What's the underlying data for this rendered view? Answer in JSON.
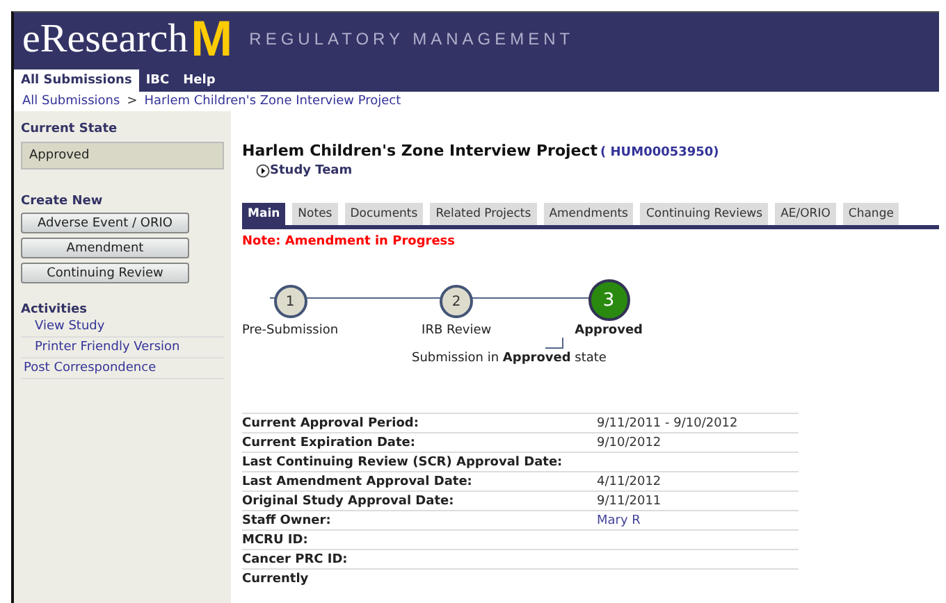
{
  "header": {
    "brand": "eResearch",
    "logo_letter": "M",
    "product": "REGULATORY MANAGEMENT"
  },
  "nav": [
    {
      "label": "All Submissions",
      "selected": true
    },
    {
      "label": "IBC",
      "selected": false
    },
    {
      "label": "Help",
      "selected": false
    }
  ],
  "breadcrumb": [
    "All Submissions",
    ">",
    "Harlem Children's Zone Interview Project"
  ],
  "sidebar": {
    "current_state_title": "Current State",
    "current_state": "Approved",
    "create_new_title": "Create New",
    "create_buttons": [
      "Adverse Event / ORIO",
      "Amendment",
      "Continuing Review"
    ],
    "activities_title": "Activities",
    "activities": [
      {
        "label": "View Study",
        "kind": "sub"
      },
      {
        "label": "Printer Friendly Version",
        "kind": "sub"
      },
      {
        "label": "Post Correspondence",
        "kind": "main"
      }
    ]
  },
  "project": {
    "title": "Harlem Children's Zone Interview Project",
    "id": "( HUM00053950)",
    "study_team": "Study Team"
  },
  "tabs": [
    {
      "label": "Main",
      "selected": true
    },
    {
      "label": "Notes",
      "selected": false
    },
    {
      "label": "Documents",
      "selected": false
    },
    {
      "label": "Related Projects",
      "selected": false
    },
    {
      "label": "Amendments",
      "selected": false
    },
    {
      "label": "Continuing Reviews",
      "selected": false
    },
    {
      "label": "AE/ORIO",
      "selected": false
    },
    {
      "label": "Change",
      "selected": false
    }
  ],
  "note": "Note: Amendment in Progress",
  "steps": [
    {
      "number": "1",
      "label": "Pre-Submission",
      "selected": false
    },
    {
      "number": "2",
      "label": "IRB Review",
      "selected": false
    },
    {
      "number": "3",
      "label": "Approved",
      "selected": true
    }
  ],
  "step_caption": "Submission in **Approved** state",
  "details": [
    {
      "label": "Current Approval Period:",
      "value": "9/11/2011 - 9/10/2012",
      "kind": "text"
    },
    {
      "label": "Current Expiration Date:",
      "value": "9/10/2012",
      "kind": "text"
    },
    {
      "label": "Last Continuing Review (SCR) Approval Date:",
      "kind": "text"
    },
    {
      "label": "Last Amendment Approval Date:",
      "value": "4/11/2012",
      "kind": "text"
    },
    {
      "label": "Original Study Approval Date:",
      "value": "9/11/2011",
      "kind": "text"
    },
    {
      "label": "Staff Owner:",
      "value": "Mary R",
      "kind": "link"
    },
    {
      "label": "MCRU ID:",
      "kind": "text"
    },
    {
      "label": "Cancer PRC ID:",
      "kind": "text"
    },
    {
      "label": "Currently",
      "kind": "text"
    }
  ]
}
